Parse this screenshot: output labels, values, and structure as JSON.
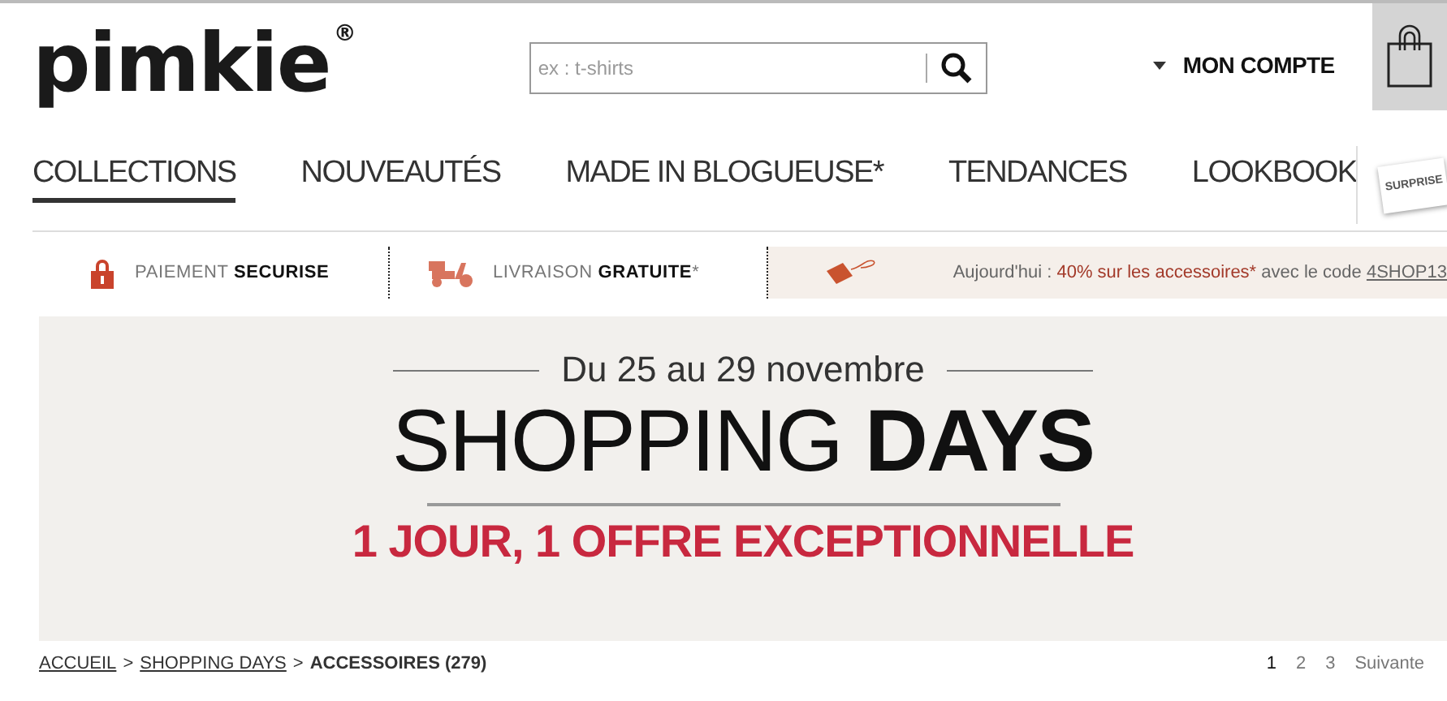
{
  "header": {
    "logo": "pimkie",
    "logo_mark": "®",
    "search": {
      "placeholder": "ex : t-shirts"
    },
    "account": "MON COMPTE"
  },
  "nav": [
    {
      "label": "COLLECTIONS",
      "selected": true
    },
    {
      "label": "NOUVEAUTÉS",
      "selected": false
    },
    {
      "label": "MADE IN BLOGUEUSE*",
      "selected": false
    },
    {
      "label": "TENDANCES",
      "selected": false
    },
    {
      "label": "LOOKBOOK",
      "selected": false
    }
  ],
  "surprise_badge": "SURPRISE",
  "info_bar": [
    {
      "kind": "lock",
      "text": "PAIEMENT **SECURISE**"
    },
    {
      "kind": "scooter",
      "text": "LIVRAISON **GRATUITE***"
    }
  ],
  "promo": {
    "prefix": "Aujourd'hui : ",
    "offer": "40% sur les accessoires*",
    "middle": " avec le code ",
    "code": "4SHOP13"
  },
  "banner": {
    "dates": "Du 25 au 29 novembre",
    "title": "SHOPPING **DAYS**",
    "subtitle": "1 JOUR, 1 OFFRE EXCEPTIONNELLE"
  },
  "breadcrumb": [
    {
      "label": "ACCUEIL",
      "link": true
    },
    {
      "label": "SHOPPING DAYS",
      "link": true
    },
    {
      "label": "ACCESSOIRES (279)",
      "link": false
    }
  ],
  "breadcrumb_separator": ">",
  "pagination": [
    {
      "label": "1",
      "selected": true
    },
    {
      "label": "2",
      "selected": false
    },
    {
      "label": "3",
      "selected": false
    },
    {
      "label": "Suivante",
      "selected": false
    }
  ]
}
